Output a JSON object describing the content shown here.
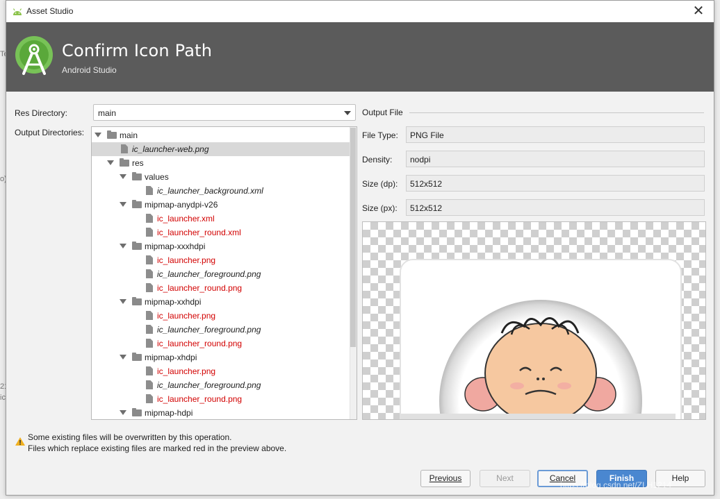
{
  "window": {
    "title": "Asset Studio",
    "close_glyph": "✕"
  },
  "banner": {
    "heading": "Confirm Icon Path",
    "subheading": "Android Studio",
    "logo_icon": "android-studio-logo-icon"
  },
  "form": {
    "res_directory_label": "Res Directory:",
    "res_directory_value": "main",
    "output_directories_label": "Output Directories:"
  },
  "tree": [
    {
      "name": "main",
      "kind": "folder",
      "depth": 0,
      "expanded": true,
      "style": "normal"
    },
    {
      "name": "ic_launcher-web.png",
      "kind": "file",
      "depth": 1,
      "style": "italic",
      "selected": true
    },
    {
      "name": "res",
      "kind": "folder",
      "depth": 1,
      "expanded": true,
      "style": "normal"
    },
    {
      "name": "values",
      "kind": "folder",
      "depth": 2,
      "expanded": true,
      "style": "normal"
    },
    {
      "name": "ic_launcher_background.xml",
      "kind": "file",
      "depth": 3,
      "style": "italic"
    },
    {
      "name": "mipmap-anydpi-v26",
      "kind": "folder",
      "depth": 2,
      "expanded": true,
      "style": "normal"
    },
    {
      "name": "ic_launcher.xml",
      "kind": "file",
      "depth": 3,
      "style": "red"
    },
    {
      "name": "ic_launcher_round.xml",
      "kind": "file",
      "depth": 3,
      "style": "red"
    },
    {
      "name": "mipmap-xxxhdpi",
      "kind": "folder",
      "depth": 2,
      "expanded": true,
      "style": "normal"
    },
    {
      "name": "ic_launcher.png",
      "kind": "file",
      "depth": 3,
      "style": "red"
    },
    {
      "name": "ic_launcher_foreground.png",
      "kind": "file",
      "depth": 3,
      "style": "italic"
    },
    {
      "name": "ic_launcher_round.png",
      "kind": "file",
      "depth": 3,
      "style": "red"
    },
    {
      "name": "mipmap-xxhdpi",
      "kind": "folder",
      "depth": 2,
      "expanded": true,
      "style": "normal"
    },
    {
      "name": "ic_launcher.png",
      "kind": "file",
      "depth": 3,
      "style": "red"
    },
    {
      "name": "ic_launcher_foreground.png",
      "kind": "file",
      "depth": 3,
      "style": "italic"
    },
    {
      "name": "ic_launcher_round.png",
      "kind": "file",
      "depth": 3,
      "style": "red"
    },
    {
      "name": "mipmap-xhdpi",
      "kind": "folder",
      "depth": 2,
      "expanded": true,
      "style": "normal"
    },
    {
      "name": "ic_launcher.png",
      "kind": "file",
      "depth": 3,
      "style": "red"
    },
    {
      "name": "ic_launcher_foreground.png",
      "kind": "file",
      "depth": 3,
      "style": "italic"
    },
    {
      "name": "ic_launcher_round.png",
      "kind": "file",
      "depth": 3,
      "style": "red"
    },
    {
      "name": "mipmap-hdpi",
      "kind": "folder",
      "depth": 2,
      "expanded": true,
      "style": "normal"
    }
  ],
  "output_file": {
    "section_label": "Output File",
    "file_type_label": "File Type:",
    "file_type_value": "PNG File",
    "density_label": "Density:",
    "density_value": "nodpi",
    "size_dp_label": "Size (dp):",
    "size_dp_value": "512x512",
    "size_px_label": "Size (px):",
    "size_px_value": "512x512"
  },
  "warning": {
    "icon": "warning-triangle-icon",
    "line1": "Some existing files will be overwritten by this operation.",
    "line2": "Files which replace existing files are marked red in the preview above."
  },
  "buttons": {
    "previous": "Previous",
    "next": "Next",
    "cancel": "Cancel",
    "finish": "Finish",
    "help": "Help"
  },
  "watermark": "https://blog.csdn.net/ZLH1214",
  "background_fragments": [
    "Te",
    "o)",
    "21",
    "ic"
  ],
  "colors": {
    "banner_bg": "#5b5b5b",
    "overwrite_red": "#d20000",
    "primary_button": "#4a87d0",
    "android_green": "#78c257"
  }
}
